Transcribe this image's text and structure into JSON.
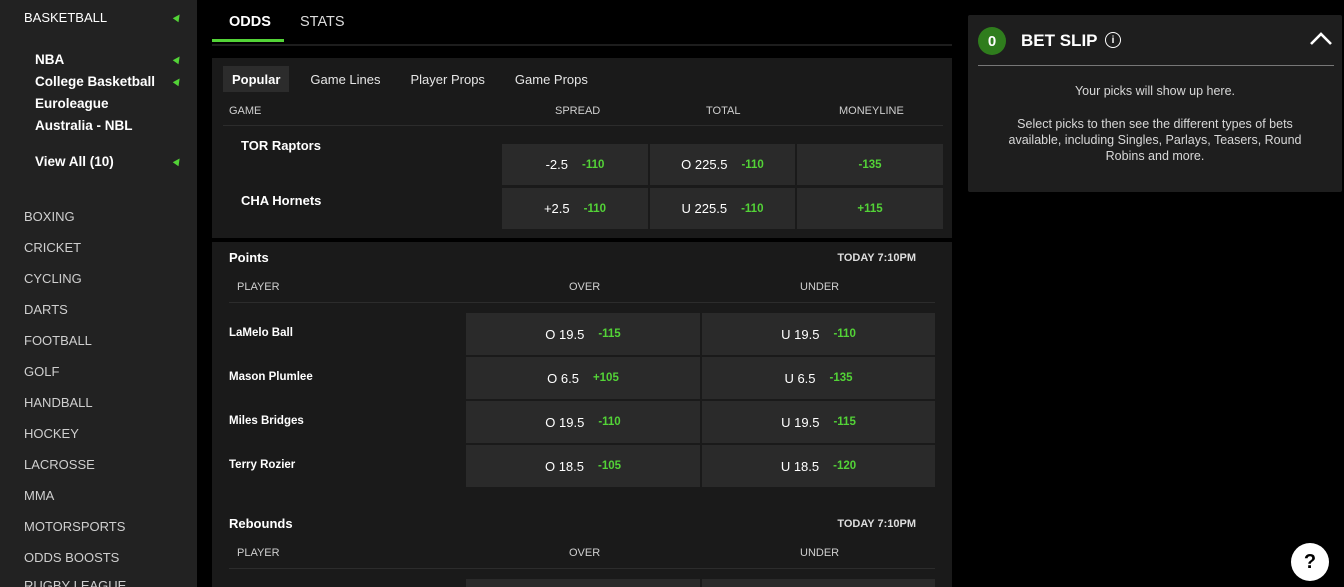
{
  "sidebar": {
    "basketball": "BASKETBALL",
    "leagues": [
      "NBA",
      "College Basketball",
      "Euroleague",
      "Australia - NBL"
    ],
    "view_all": "View All (10)",
    "sports": [
      "BOXING",
      "CRICKET",
      "CYCLING",
      "DARTS",
      "FOOTBALL",
      "GOLF",
      "HANDBALL",
      "HOCKEY",
      "LACROSSE",
      "MMA",
      "MOTORSPORTS",
      "ODDS BOOSTS",
      "RUGBY LEAGUE"
    ]
  },
  "tabs": {
    "odds": "ODDS",
    "stats": "STATS"
  },
  "subtabs": [
    "Popular",
    "Game Lines",
    "Player Props",
    "Game Props"
  ],
  "game_lines": {
    "headers": {
      "game": "GAME",
      "spread": "SPREAD",
      "total": "TOTAL",
      "moneyline": "MONEYLINE"
    },
    "teams": [
      {
        "name": "TOR Raptors",
        "spread": "-2.5",
        "spread_odds": "-110",
        "total": "O 225.5",
        "total_odds": "-110",
        "moneyline": "-135"
      },
      {
        "name": "CHA Hornets",
        "spread": "+2.5",
        "spread_odds": "-110",
        "total": "U 225.5",
        "total_odds": "-110",
        "moneyline": "+115"
      }
    ]
  },
  "points": {
    "title": "Points",
    "time": "TODAY 7:10PM",
    "headers": {
      "player": "PLAYER",
      "over": "OVER",
      "under": "UNDER"
    },
    "rows": [
      {
        "player": "LaMelo Ball",
        "over": "O 19.5",
        "over_odds": "-115",
        "under": "U 19.5",
        "under_odds": "-110"
      },
      {
        "player": "Mason Plumlee",
        "over": "O 6.5",
        "over_odds": "+105",
        "under": "U 6.5",
        "under_odds": "-135"
      },
      {
        "player": "Miles Bridges",
        "over": "O 19.5",
        "over_odds": "-110",
        "under": "U 19.5",
        "under_odds": "-115"
      },
      {
        "player": "Terry Rozier",
        "over": "O 18.5",
        "over_odds": "-105",
        "under": "U 18.5",
        "under_odds": "-120"
      }
    ]
  },
  "rebounds": {
    "title": "Rebounds",
    "time": "TODAY 7:10PM",
    "headers": {
      "player": "PLAYER",
      "over": "OVER",
      "under": "UNDER"
    }
  },
  "betslip": {
    "count": "0",
    "title": "BET SLIP",
    "info": "i",
    "empty": "Your picks will show up here.",
    "description": "Select picks to then see the different types of bets available, including Singles, Parlays, Teasers, Round Robins and more."
  },
  "help": "?",
  "colors": {
    "accent": "#53d337",
    "badge": "#2f7d1d"
  }
}
